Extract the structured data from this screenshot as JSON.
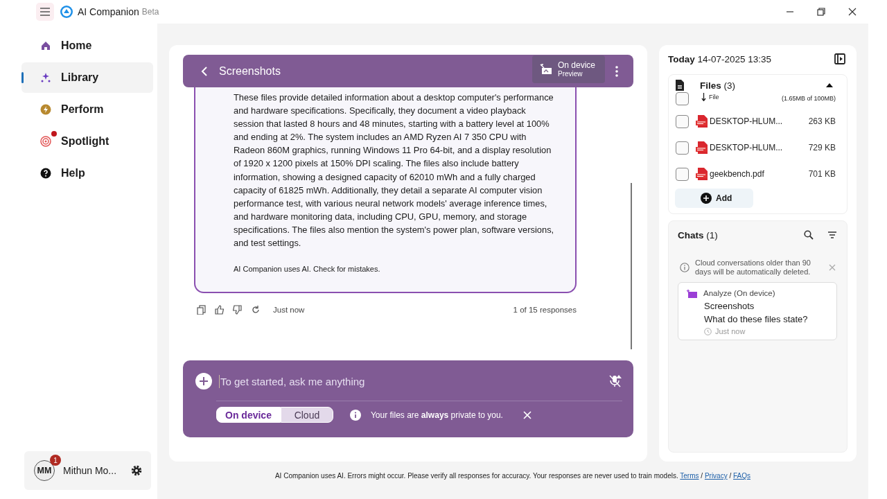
{
  "app": {
    "title": "AI Companion",
    "badge": "Beta"
  },
  "nav": [
    {
      "kind": "home",
      "label": "Home",
      "selected": false,
      "notification": false
    },
    {
      "kind": "library",
      "label": "Library",
      "selected": true,
      "notification": false
    },
    {
      "kind": "perform",
      "label": "Perform",
      "selected": false,
      "notification": false
    },
    {
      "kind": "spotlight",
      "label": "Spotlight",
      "selected": false,
      "notification": true
    },
    {
      "kind": "help",
      "label": "Help",
      "selected": false,
      "notification": false
    }
  ],
  "user": {
    "initials": "MM",
    "name": "Mithun Mo...",
    "badge": "1"
  },
  "chat": {
    "title": "Screenshots",
    "mode": {
      "label": "On device",
      "sub": "Preview"
    },
    "message": "These files provide detailed information about a desktop computer's performance and hardware specifications. Specifically, they document a video playback session that lasted 8 hours and 48 minutes, starting with a battery level at 100% and ending at 2%. The system includes an AMD Ryzen AI 7 350 CPU with Radeon 860M graphics, running Windows 11 Pro 64-bit, and a display resolution of 1920 x 1200 pixels at 150% DPI scaling. The files also include battery information, showing a designed capacity of 62010 mWh and a fully charged capacity of 61825 mWh. Additionally, they detail a separate AI computer vision performance test, with various neural network models' average inference times, and hardware monitoring data, including CPU, GPU, memory, and storage specifications. The files also mention the system's power plan, software versions, and test settings.",
    "disclaimer": "AI Companion uses AI. Check for mistakes.",
    "time": "Just now",
    "count": "1 of 15 responses"
  },
  "composer": {
    "placeholder": "To get started, ask me anything",
    "modes": [
      {
        "label": "On device",
        "selected": true
      },
      {
        "label": "Cloud",
        "selected": false
      }
    ],
    "notice": "Your files are **always** private to you."
  },
  "side": {
    "date_label": "Today",
    "datetime": "14-07-2025 13:35",
    "files": {
      "title": "Files",
      "count": "(3)",
      "expanded": true,
      "sort_label": "File",
      "usage": "(1.65MB of 100MB)",
      "all_checked": false,
      "items": [
        {
          "name": "DESKTOP-HLUM...",
          "size": "263 KB",
          "checked": false
        },
        {
          "name": "DESKTOP-HLUM...",
          "size": "729 KB",
          "checked": false
        },
        {
          "name": "geekbench.pdf",
          "size": "701 KB",
          "checked": false
        }
      ],
      "add": "Add"
    },
    "chats": {
      "title": "Chats",
      "count": "(1)",
      "notice": "Cloud conversations older than 90 days will be automatically deleted.",
      "items": [
        {
          "type": "Analyze",
          "mode": "(On device)",
          "title": "Screenshots",
          "question": "What do these files state?",
          "time": "Just now"
        }
      ]
    }
  },
  "footer": {
    "text": "AI Companion uses AI. Errors might occur. Please verify all responses for accuracy. Your responses are never used to train models.",
    "links": [
      "Terms",
      "Privacy",
      "FAQs"
    ],
    "separator": "/"
  }
}
